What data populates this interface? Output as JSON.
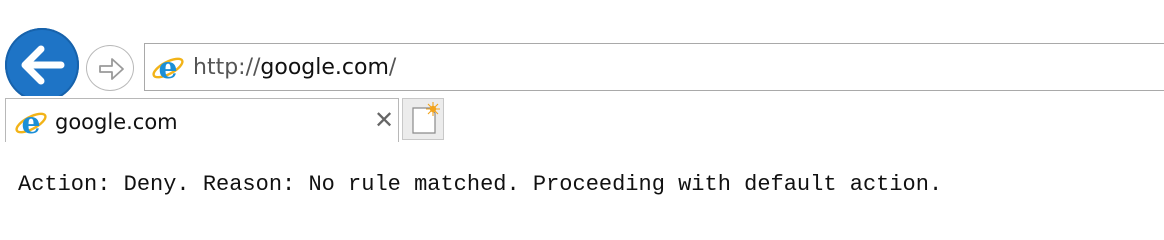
{
  "browser": {
    "navigation": {
      "back_icon": "arrow-left-icon",
      "forward_icon": "arrow-right-icon"
    },
    "address_bar": {
      "icon": "ie-logo-icon",
      "url_prefix": "http://",
      "url_host": "google.com",
      "url_suffix": "/"
    },
    "tabs": [
      {
        "icon": "ie-logo-icon",
        "title": "google.com",
        "close_icon": "close-icon"
      }
    ],
    "new_tab_icon": "new-tab-icon",
    "colors": {
      "back_button": "#1e74c6",
      "ie_logo": "#1b8fd6"
    }
  },
  "page": {
    "message": "Action: Deny. Reason: No rule matched. Proceeding with default action."
  }
}
